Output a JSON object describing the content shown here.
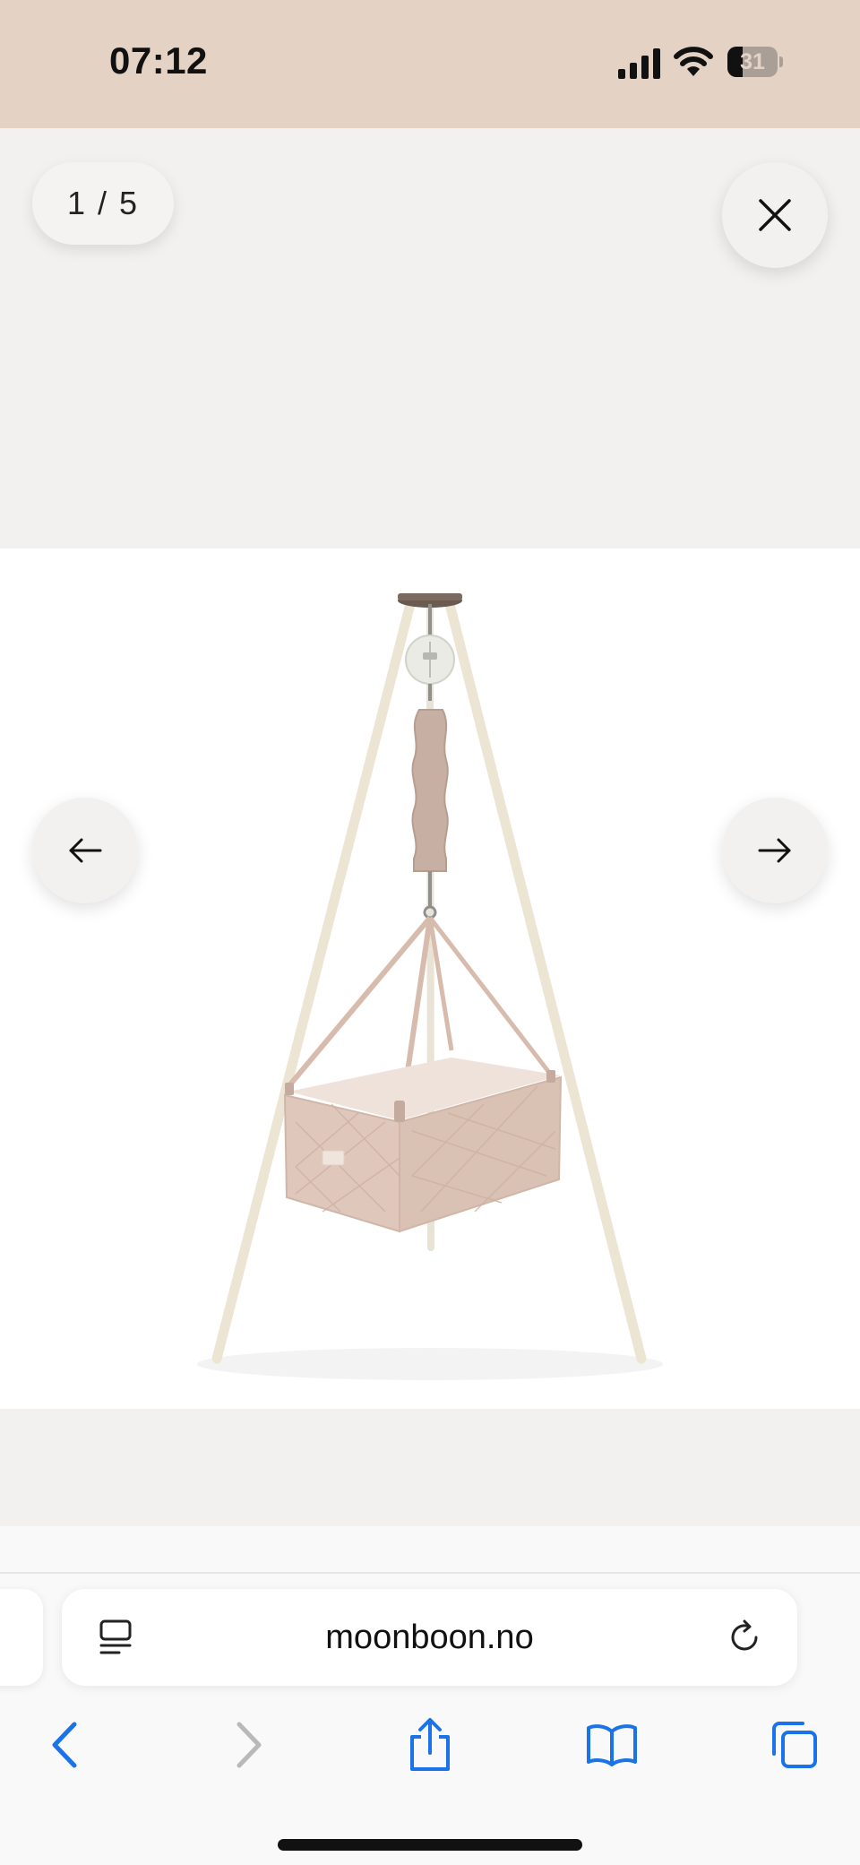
{
  "status_bar": {
    "time": "07:12",
    "battery_level": "31",
    "battery_fraction": 0.31,
    "icons": [
      "signal-icon",
      "wifi-icon",
      "battery-icon"
    ]
  },
  "gallery": {
    "counter": "1 / 5",
    "current_index": 1,
    "total": 5,
    "icons": [
      "close-icon",
      "arrow-left-icon",
      "arrow-right-icon"
    ]
  },
  "browser": {
    "url": "moonboon.no",
    "icons": [
      "reader-icon",
      "reload-icon",
      "back-icon",
      "forward-icon",
      "share-icon",
      "bookmarks-icon",
      "tabs-icon"
    ],
    "accent_color": "#1a73e8",
    "disabled_color": "#b9b9b9"
  },
  "colors": {
    "status_bar_bg": "#e4d3c5",
    "viewer_bg": "#f2f1f0",
    "image_bg": "#ffffff"
  }
}
